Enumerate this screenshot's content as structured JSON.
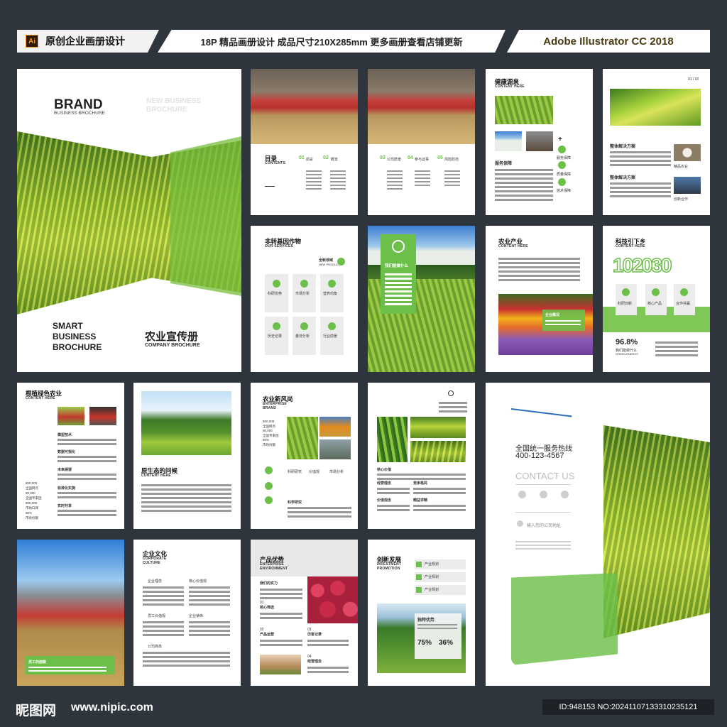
{
  "header": {
    "ai_badge": "Ai",
    "left_title": "原创企业画册设计",
    "middle": "18P 精品画册设计 成品尺寸210X285mm 更多画册查看店铺更新",
    "right": "Adobe Illustrator CC 2018"
  },
  "cover": {
    "brand": "BRAND",
    "brand_sub": "BUSINESS BROCHURE",
    "new_business": "NEW BUSINESS",
    "brochure": "BROCHURE",
    "smart1": "SMART",
    "smart2": "BUSINESS",
    "smart3": "BROCHURE",
    "cn_title": "农业宣传册",
    "en_title": "COMPANY BROCHURE"
  },
  "p2": {
    "title": "目录",
    "sub": "CONTENTS",
    "n1": "01",
    "h1": "前言",
    "n2": "02",
    "h2": "概览"
  },
  "p3": {
    "n3": "03",
    "h3": "公司愿景",
    "n4": "04",
    "h4": "参与证事",
    "n5": "05",
    "h5": "风险防范"
  },
  "p4": {
    "title": "健康源泉",
    "sub": "CONTENT HERE",
    "service": "服务保障",
    "b1": "服务保障",
    "b2": "质量保障",
    "b3": "技术保障"
  },
  "p5": {
    "pages": "01 / 02",
    "s1": "整体解决方案",
    "s2": "整体解决方案",
    "l1": "精品农业",
    "l2": "创新合作"
  },
  "p6": {
    "title": "非转基因作物",
    "sub": "OUR SERVICES",
    "badge": "全新领域",
    "badge_sub": "NEW PRODUCTS",
    "items": [
      "科研优势",
      "市场分析",
      "营养均衡",
      "历史记录",
      "量非分析",
      "行业前景"
    ]
  },
  "p7": {
    "box_title": "我们能做什么"
  },
  "p8": {
    "title": "农业产业",
    "sub": "CONTENT HERE",
    "label": "企业概况"
  },
  "p9": {
    "title": "科技引下乡",
    "sub": "CONTENT HERE",
    "n1": "1",
    "n2": "2",
    "n3": "3",
    "n0": "0",
    "i1": "科研创新",
    "i2": "核心产品",
    "i3": "合作共赢",
    "pct": "96.8%",
    "pct_label": "我们能做什么",
    "pct_sub": "GREEN ENERGY"
  },
  "p10": {
    "title": "根植绿色农业",
    "sub": "CONTENT HERE",
    "a": "模型技术",
    "b": "数据可视化",
    "c": "未来展望",
    "d": "标准化实施",
    "e": "实时共享",
    "stats": [
      "800,000",
      "全国网点",
      "80,000",
      "全国专家团",
      "800,000",
      "市场口碑",
      "90%",
      "市场份额"
    ]
  },
  "p11": {
    "title": "原生态的问候",
    "sub": "CONTENT HERE"
  },
  "p12": {
    "title": "农业新风尚",
    "sub": "ENTERPRISE",
    "sub2": "BRAND",
    "stats": [
      "800,000",
      "全国网点",
      "80,000",
      "全国专家团",
      "90%",
      "市场份额"
    ],
    "r1": "科研研究",
    "r2": "价值观",
    "r3": "市场分析",
    "r4": "科学研究"
  },
  "p13": {
    "a": "核心价值",
    "b": "经营理念",
    "c": "竞争格局",
    "d": "价值观念",
    "e": "精益求精"
  },
  "p14": {
    "hotline": "全国统一服务热线",
    "phone": "400-123-4567",
    "contact": "CONTACT US",
    "address": "输入您的公司地址"
  },
  "p15": {
    "label": "员工的面貌"
  },
  "p16": {
    "title": "企业文化",
    "sub": "CORPORATE",
    "sub2": "CULTURE",
    "a": "企业理念",
    "b": "核心价值观",
    "c": "员工价值观",
    "d": "企业使命",
    "e": "公司简单"
  },
  "p17": {
    "title": "产品优势",
    "sub": "ENTERPRISE",
    "sub2": "ENVIRONMENT",
    "a": "我们的实力",
    "n1": "01",
    "b": "核心筛选",
    "n2": "02",
    "c": "产品运营",
    "n3": "03",
    "d": "仿客记录",
    "n4": "04",
    "e": "经营理念"
  },
  "p18": {
    "title": "创新发展",
    "sub": "INVESTMENT",
    "sub2": "PROMOTION",
    "a": "产业规划",
    "b": "产业规划",
    "c": "产业规划",
    "box": "独特优势",
    "v1": "75%",
    "v2": "36%"
  },
  "footer": {
    "logo": "昵图网",
    "url": "www.nipic.com",
    "id": "ID:948153 NO:20241107133310235121"
  },
  "colors": {
    "accent": "#6cc04a",
    "bg": "#2f353c"
  }
}
